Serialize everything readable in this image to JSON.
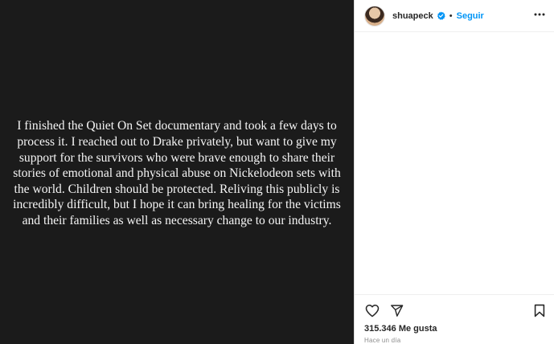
{
  "post": {
    "caption": "I finished the Quiet On Set documentary and took a few days to process it. I reached out to Drake privately, but want to give my support for the survivors who were brave enough to share their stories of emotional and physical abuse on Nickelodeon sets with the world. Children should be protected. Reliving this publicly is incredibly difficult, but I hope it can bring healing for the victims and their families as well as necessary change to our industry."
  },
  "header": {
    "username": "shuapeck",
    "separator": "•",
    "follow_label": "Seguir",
    "avatar_icon": "profile-avatar",
    "verified_icon": "verified-badge-icon",
    "more_icon": "more-options-icon",
    "accent_color": "#0095f6"
  },
  "actions": {
    "like_icon": "heart-icon",
    "share_icon": "send-icon",
    "save_icon": "bookmark-icon",
    "likes_count": "315.346",
    "likes_label": "Me gusta",
    "timestamp": "Hace un día"
  }
}
